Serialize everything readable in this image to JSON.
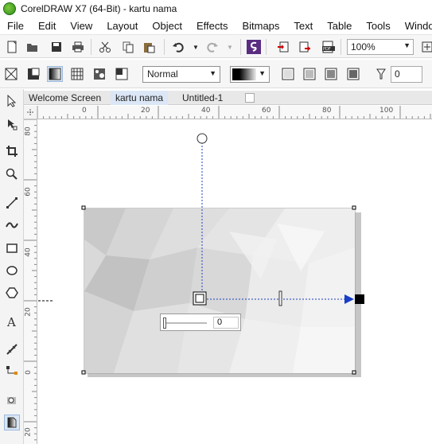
{
  "app": {
    "title": "CorelDRAW X7 (64-Bit) - kartu nama"
  },
  "menu": [
    "File",
    "Edit",
    "View",
    "Layout",
    "Object",
    "Effects",
    "Bitmaps",
    "Text",
    "Table",
    "Tools",
    "Window"
  ],
  "toolbar": {
    "zoom": "100%"
  },
  "property_bar": {
    "merge_mode": "Normal",
    "transparency_value": "0"
  },
  "tabs": [
    "Welcome Screen",
    "kartu nama",
    "Untitled-1"
  ],
  "active_tab": "kartu nama",
  "rulers": {
    "horizontal": [
      "0",
      "20",
      "40",
      "60",
      "80",
      "100"
    ],
    "vertical": [
      "80",
      "60",
      "40",
      "20",
      "0",
      "20"
    ]
  },
  "transparency_slider": {
    "value": "0",
    "level": 0
  },
  "colors": {
    "accent": "#1a3fc4",
    "tab_active": "#dbe7f6",
    "node_end": "#000000"
  }
}
